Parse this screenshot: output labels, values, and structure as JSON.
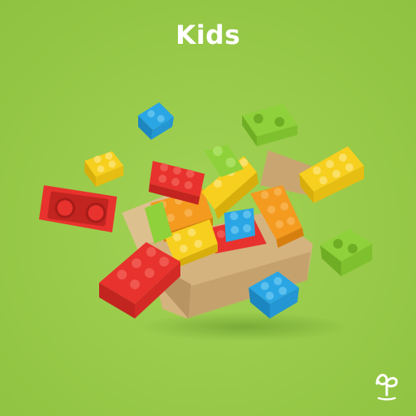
{
  "cover": {
    "title": "Kids",
    "background_color": "#9acb4b",
    "title_color": "#ffffff"
  },
  "artwork": {
    "subject": "toy-bricks-bursting-from-box",
    "brick_colors": {
      "red": "#e8322d",
      "orange": "#f49a1f",
      "yellow": "#f7cf1e",
      "blue": "#2aa6e5",
      "lime": "#8fd13a",
      "cardboard": "#d8b987"
    }
  },
  "brand": {
    "logo_icon": "brand-logo-icon"
  }
}
